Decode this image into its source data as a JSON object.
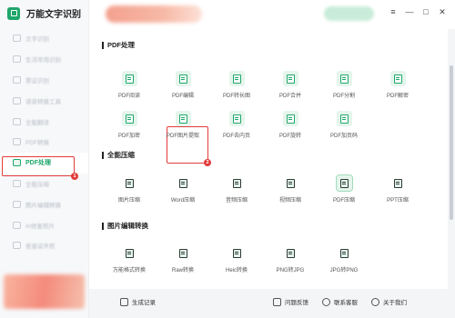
{
  "app": {
    "title": "万能文字识别"
  },
  "window_controls": {
    "menu": "≡",
    "minimize": "—",
    "maximize": "□",
    "close": "✕"
  },
  "sidebar": {
    "items": [
      {
        "label": "文字识别",
        "icon": "text-recognize-icon"
      },
      {
        "label": "生活常用识别",
        "icon": "life-recognize-icon"
      },
      {
        "label": "票证识别",
        "icon": "ticket-recognize-icon"
      },
      {
        "label": "语音转换工具",
        "icon": "voice-convert-icon"
      },
      {
        "label": "全能翻译",
        "icon": "translate-icon"
      },
      {
        "label": "PDF转换",
        "icon": "pdf-convert-icon"
      },
      {
        "label": "PDF处理",
        "icon": "pdf-process-icon",
        "active": true
      },
      {
        "label": "全能压缩",
        "icon": "compress-icon"
      },
      {
        "label": "图片编辑转换",
        "icon": "image-edit-icon"
      },
      {
        "label": "AI修复照片",
        "icon": "ai-photo-icon"
      },
      {
        "label": "星座证件照",
        "icon": "id-photo-icon"
      }
    ],
    "badge": "1"
  },
  "sections": [
    {
      "title": "PDF处理",
      "tools": [
        "PDF阅读",
        "PDF编辑",
        "PDF转长图",
        "PDF合并",
        "PDF分割",
        "PDF解密",
        "PDF加密",
        "PDF图片提取",
        "PDF去内页",
        "PDF旋转",
        "PDF加页码"
      ]
    },
    {
      "title": "全能压缩",
      "tools": [
        "图片压缩",
        "Word压缩",
        "音频压缩",
        "视频压缩",
        "PDF压缩",
        "PPT压缩"
      ]
    },
    {
      "title": "图片编辑转换",
      "tools": [
        "万能格式转换",
        "Raw转换",
        "Heic转换",
        "PNG转JPG",
        "JPG转PNG"
      ]
    }
  ],
  "highlight_badge": "2",
  "footer": {
    "records": "生成记录",
    "feedback": "问题反馈",
    "contact": "联系客服",
    "about": "关于我们"
  },
  "colors": {
    "accent": "#1fa66a",
    "annotation": "#e23b3b"
  }
}
